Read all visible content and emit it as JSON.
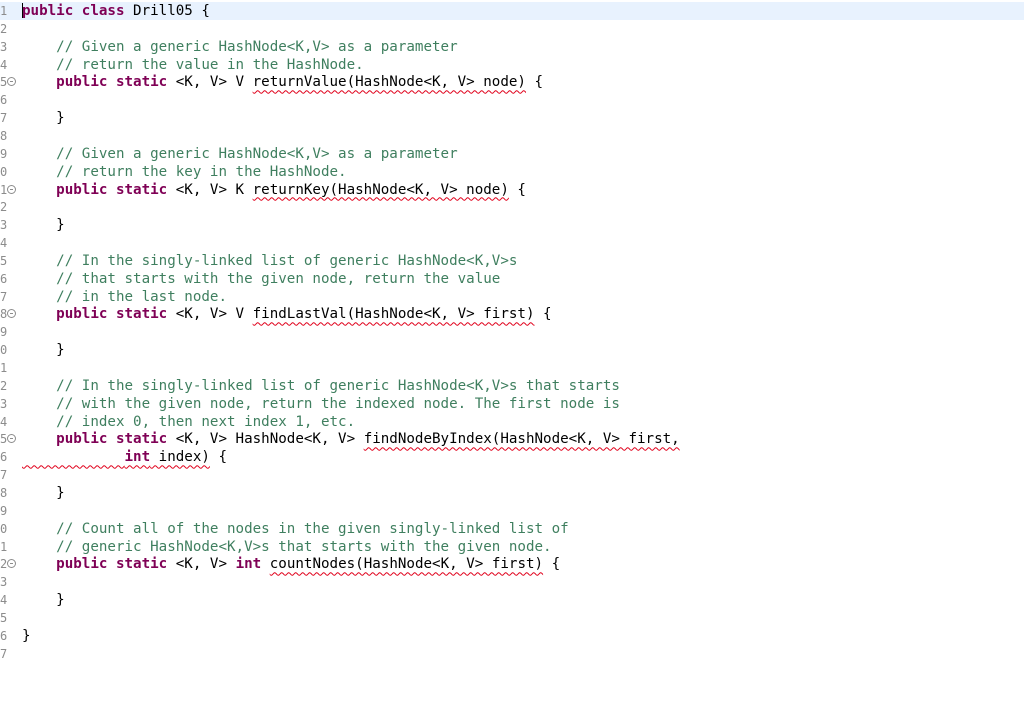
{
  "editor": {
    "line_numbers": [
      "1",
      "2",
      "3",
      "4",
      "5",
      "6",
      "7",
      "8",
      "9",
      "0",
      "1",
      "2",
      "3",
      "4",
      "5",
      "6",
      "7",
      "8",
      "9",
      "0",
      "1",
      "2",
      "3",
      "4",
      "5",
      "6",
      "7",
      "8",
      "9",
      "0",
      "1",
      "2",
      "3",
      "4",
      "5",
      "6",
      "7"
    ],
    "lines": [
      [
        {
          "t": "public class ",
          "c": "kw"
        },
        {
          "t": "Drill05 {"
        }
      ],
      [],
      [
        {
          "t": "    // Given a generic HashNode<K,V> as a parameter",
          "c": "cm"
        }
      ],
      [
        {
          "t": "    // return the value in the HashNode.",
          "c": "cm"
        }
      ],
      [
        {
          "t": "    "
        },
        {
          "t": "public static ",
          "c": "kw"
        },
        {
          "t": "<K, V> V "
        },
        {
          "t": "returnValue(HashNode<K, V> node)",
          "c": "err"
        },
        {
          "t": " {"
        }
      ],
      [],
      [
        {
          "t": "    }"
        }
      ],
      [],
      [
        {
          "t": "    // Given a generic HashNode<K,V> as a parameter",
          "c": "cm"
        }
      ],
      [
        {
          "t": "    // return the key in the HashNode.",
          "c": "cm"
        }
      ],
      [
        {
          "t": "    "
        },
        {
          "t": "public static ",
          "c": "kw"
        },
        {
          "t": "<K, V> K "
        },
        {
          "t": "returnKey(HashNode<K, V> node)",
          "c": "err"
        },
        {
          "t": " {"
        }
      ],
      [],
      [
        {
          "t": "    }"
        }
      ],
      [],
      [
        {
          "t": "    // In the singly-linked list of generic HashNode<K,V>s",
          "c": "cm"
        }
      ],
      [
        {
          "t": "    // that starts with the given node, return the value",
          "c": "cm"
        }
      ],
      [
        {
          "t": "    // in the last node.",
          "c": "cm"
        }
      ],
      [
        {
          "t": "    "
        },
        {
          "t": "public static ",
          "c": "kw"
        },
        {
          "t": "<K, V> V "
        },
        {
          "t": "findLastVal(HashNode<K, V> first)",
          "c": "err"
        },
        {
          "t": " {"
        }
      ],
      [],
      [
        {
          "t": "    }"
        }
      ],
      [],
      [
        {
          "t": "    // In the singly-linked list of generic HashNode<K,V>s that starts",
          "c": "cm"
        }
      ],
      [
        {
          "t": "    // with the given node, return the indexed node. The first node is",
          "c": "cm"
        }
      ],
      [
        {
          "t": "    // index 0, then next index 1, etc.",
          "c": "cm"
        }
      ],
      [
        {
          "t": "    "
        },
        {
          "t": "public static ",
          "c": "kw"
        },
        {
          "t": "<K, V> HashNode<K, V> "
        },
        {
          "t": "findNodeByIndex(HashNode<K, V> first,",
          "c": "err"
        }
      ],
      [
        {
          "t": "            ",
          "c": "err"
        },
        {
          "t": "int",
          "c": "kw err"
        },
        {
          "t": " index)",
          "c": "err"
        },
        {
          "t": " {"
        }
      ],
      [],
      [
        {
          "t": "    }"
        }
      ],
      [],
      [
        {
          "t": "    // Count all of the nodes in the given singly-linked list of",
          "c": "cm"
        }
      ],
      [
        {
          "t": "    // generic HashNode<K,V>s that starts with the given node.",
          "c": "cm"
        }
      ],
      [
        {
          "t": "    "
        },
        {
          "t": "public static ",
          "c": "kw"
        },
        {
          "t": "<K, V> "
        },
        {
          "t": "int ",
          "c": "kw"
        },
        {
          "t": "countNodes(HashNode<K, V> first)",
          "c": "err"
        },
        {
          "t": " {"
        }
      ],
      [],
      [
        {
          "t": "    }"
        }
      ],
      [],
      [
        {
          "t": "}"
        }
      ],
      []
    ]
  }
}
